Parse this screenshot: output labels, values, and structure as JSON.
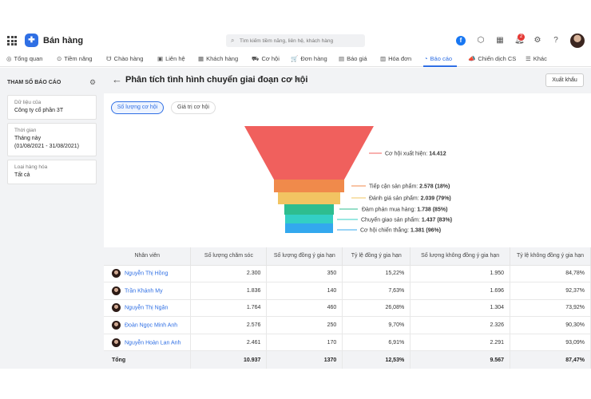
{
  "app": {
    "title": "Bán hàng",
    "logo_glyph": "✚"
  },
  "search": {
    "placeholder": "Tìm kiếm tiềm năng, liên hệ, khách hàng"
  },
  "header_icons": [
    "facebook-icon",
    "cube-icon",
    "calendar-icon",
    "bell-icon",
    "gear-icon",
    "help-icon",
    "avatar"
  ],
  "notification_count": "2",
  "nav": {
    "items": [
      {
        "label": "Tổng quan",
        "icon": "◎"
      },
      {
        "label": "Tiềm năng",
        "icon": "⊙"
      },
      {
        "label": "Chào hàng",
        "icon": "☋"
      },
      {
        "label": "Liên hệ",
        "icon": "▣"
      },
      {
        "label": "Khách hàng",
        "icon": "▦"
      },
      {
        "label": "Cơ hội",
        "icon": "⛟"
      },
      {
        "label": "Đơn hàng",
        "icon": "🛒"
      },
      {
        "label": "Báo giá",
        "icon": "▤"
      },
      {
        "label": "Hóa đơn",
        "icon": "▥"
      },
      {
        "label": "Báo cáo",
        "icon": "◔"
      },
      {
        "label": "Chiến dịch CS",
        "icon": "📣"
      },
      {
        "label": "Khác",
        "icon": "☰"
      }
    ],
    "active": "Báo cáo"
  },
  "left_panel": {
    "title": "THAM SỐ BÁO CÁO",
    "data_source": {
      "label": "Dữ liệu của",
      "value": "Công ty cổ phần 3T"
    },
    "time": {
      "label": "Thời gian",
      "value1": "Tháng này",
      "value2": "(01/08/2021 - 31/08/2021)"
    },
    "goods": {
      "label": "Loại hàng hóa",
      "value": "Tất cả"
    }
  },
  "page": {
    "title": "Phân tích tình hình chuyển giai đoạn cơ hội",
    "export_label": "Xuất khẩu",
    "tab_count": "Số lượng cơ hội",
    "tab_value": "Giá trị cơ hội"
  },
  "chart_data": {
    "type": "funnel",
    "stages": [
      {
        "label": "Cơ hội xuất hiện:",
        "value_text": "14.412",
        "value": 14412,
        "color": "#f0605d"
      },
      {
        "label": "Tiếp cận sản phẩm:",
        "value_text": "2.578 (18%)",
        "value": 2578,
        "color": "#f08a4b"
      },
      {
        "label": "Đánh giá sản phẩm:",
        "value_text": "2.039 (79%)",
        "value": 2039,
        "color": "#f2c462"
      },
      {
        "label": "Đàm phán mua hàng:",
        "value_text": "1.738 (85%)",
        "value": 1738,
        "color": "#2ebd8f"
      },
      {
        "label": "Chuyển giao sản phẩm:",
        "value_text": "1.437 (83%)",
        "value": 1437,
        "color": "#33cfc4"
      },
      {
        "label": "Cơ hội chiến thắng:",
        "value_text": "1.381 (96%)",
        "value": 1381,
        "color": "#33a8ee"
      }
    ]
  },
  "table": {
    "headers": [
      "Nhân viên",
      "Số lượng chăm sóc",
      "Số lượng đồng ý gia hạn",
      "Tỷ lệ đồng ý gia hạn",
      "Số lượng không đồng ý gia hạn",
      "Tỷ lệ không đồng ý gia hạn"
    ],
    "rows": [
      [
        "Nguyễn Thị Hồng",
        "2.300",
        "350",
        "15,22%",
        "1.950",
        "84,78%"
      ],
      [
        "Trần Khánh My",
        "1.836",
        "140",
        "7,63%",
        "1.696",
        "92,37%"
      ],
      [
        "Nguyễn Thị Ngân",
        "1.764",
        "460",
        "26,08%",
        "1.304",
        "73,92%"
      ],
      [
        "Đoàn Ngọc Minh Anh",
        "2.576",
        "250",
        "9,70%",
        "2.326",
        "90,30%"
      ],
      [
        "Nguyễn Hoàn Lan Anh",
        "2.461",
        "170",
        "6,91%",
        "2.291",
        "93,09%"
      ]
    ],
    "total": [
      "Tổng",
      "10.937",
      "1370",
      "12,53%",
      "9.567",
      "87,47%"
    ]
  }
}
